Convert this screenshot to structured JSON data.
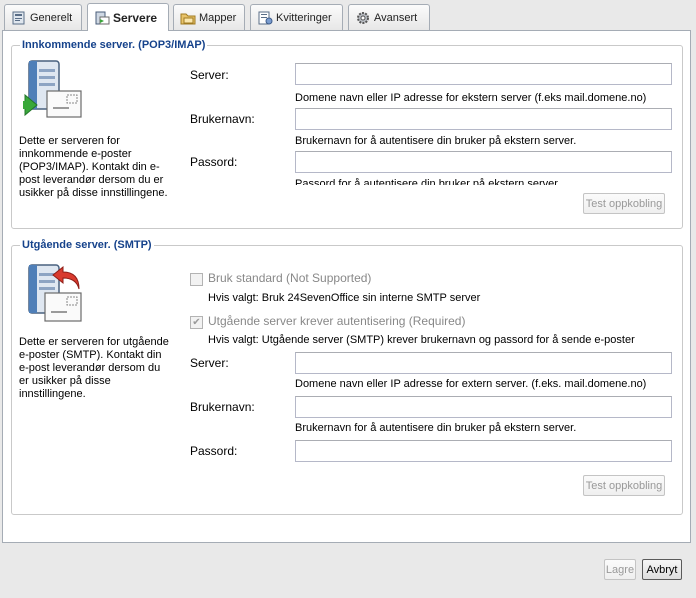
{
  "tabs": [
    {
      "label": "Generelt",
      "icon": "general-settings-icon",
      "active": false
    },
    {
      "label": "Servere",
      "icon": "server-icon",
      "active": true
    },
    {
      "label": "Mapper",
      "icon": "folder-icon",
      "active": false
    },
    {
      "label": "Kvitteringer",
      "icon": "receipt-icon",
      "active": false
    },
    {
      "label": "Avansert",
      "icon": "gear-icon",
      "active": false
    }
  ],
  "incoming": {
    "legend": "Innkommende server. (POP3/IMAP)",
    "description": "Dette er serveren for innkommende e-poster (POP3/IMAP). Kontakt din e-post leverandør dersom du er usikker på disse innstillingene.",
    "server_label": "Server:",
    "server_value": "",
    "server_help": "Domene navn eller IP adresse for ekstern server (f.eks mail.domene.no)",
    "username_label": "Brukernavn:",
    "username_value": "",
    "username_help": "Brukernavn for å autentisere din bruker på ekstern server.",
    "password_label": "Passord:",
    "password_value": "",
    "password_help": "Passord for å autentisere din bruker på ekstern server.",
    "test_button": "Test oppkobling"
  },
  "outgoing": {
    "legend": "Utgående server. (SMTP)",
    "description": "Dette er serveren for utgående e-poster (SMTP). Kontakt din e-post leverandør dersom du er usikker på disse innstillingene.",
    "use_default_label": "Bruk standard (Not Supported)",
    "use_default_checked": false,
    "use_default_help": "Hvis valgt: Bruk 24SevenOffice sin interne SMTP server",
    "requires_auth_label": "Utgående server krever autentisering (Required)",
    "requires_auth_checked": true,
    "requires_auth_help": "Hvis valgt: Utgående server (SMTP) krever brukernavn og passord for å sende e-poster",
    "server_label": "Server:",
    "server_value": "",
    "server_help": "Domene navn eller IP adresse for extern server. (f.eks. mail.domene.no)",
    "username_label": "Brukernavn:",
    "username_value": "",
    "username_help": "Brukernavn for å autentisere din bruker på ekstern server.",
    "password_label": "Passord:",
    "password_value": "",
    "test_button": "Test oppkobling"
  },
  "footer": {
    "save_button": "Lagre",
    "cancel_button": "Avbryt"
  },
  "colors": {
    "legend": "#15428b",
    "panel_border": "#a5acb5",
    "background": "#e9e9e9"
  }
}
